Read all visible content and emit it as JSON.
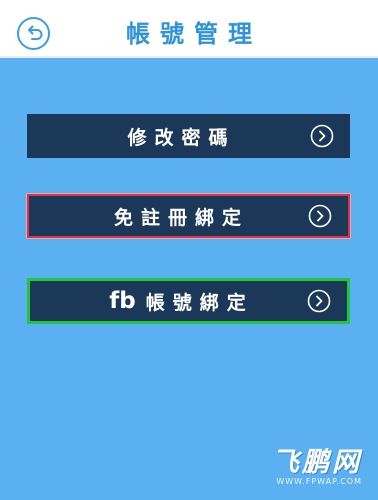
{
  "header": {
    "title": "帳號管理",
    "back_icon": "back-arrow-icon"
  },
  "menu": [
    {
      "label": "修改密碼",
      "icon": "chevron-right-circle-icon"
    },
    {
      "label": "免註冊綁定",
      "icon": "chevron-right-circle-icon",
      "border_color": "#d8344a"
    },
    {
      "prefix": "fb",
      "label": "帳號綁定",
      "icon": "chevron-right-circle-icon",
      "border_color": "#21c63a"
    }
  ],
  "watermark": {
    "logo": "飞鹏网",
    "url": "WWW.FPWAP.COM"
  },
  "colors": {
    "background": "#5ab0f0",
    "header_bg": "#ffffff",
    "accent": "#2e93d8",
    "button_bg": "#1c3859"
  }
}
